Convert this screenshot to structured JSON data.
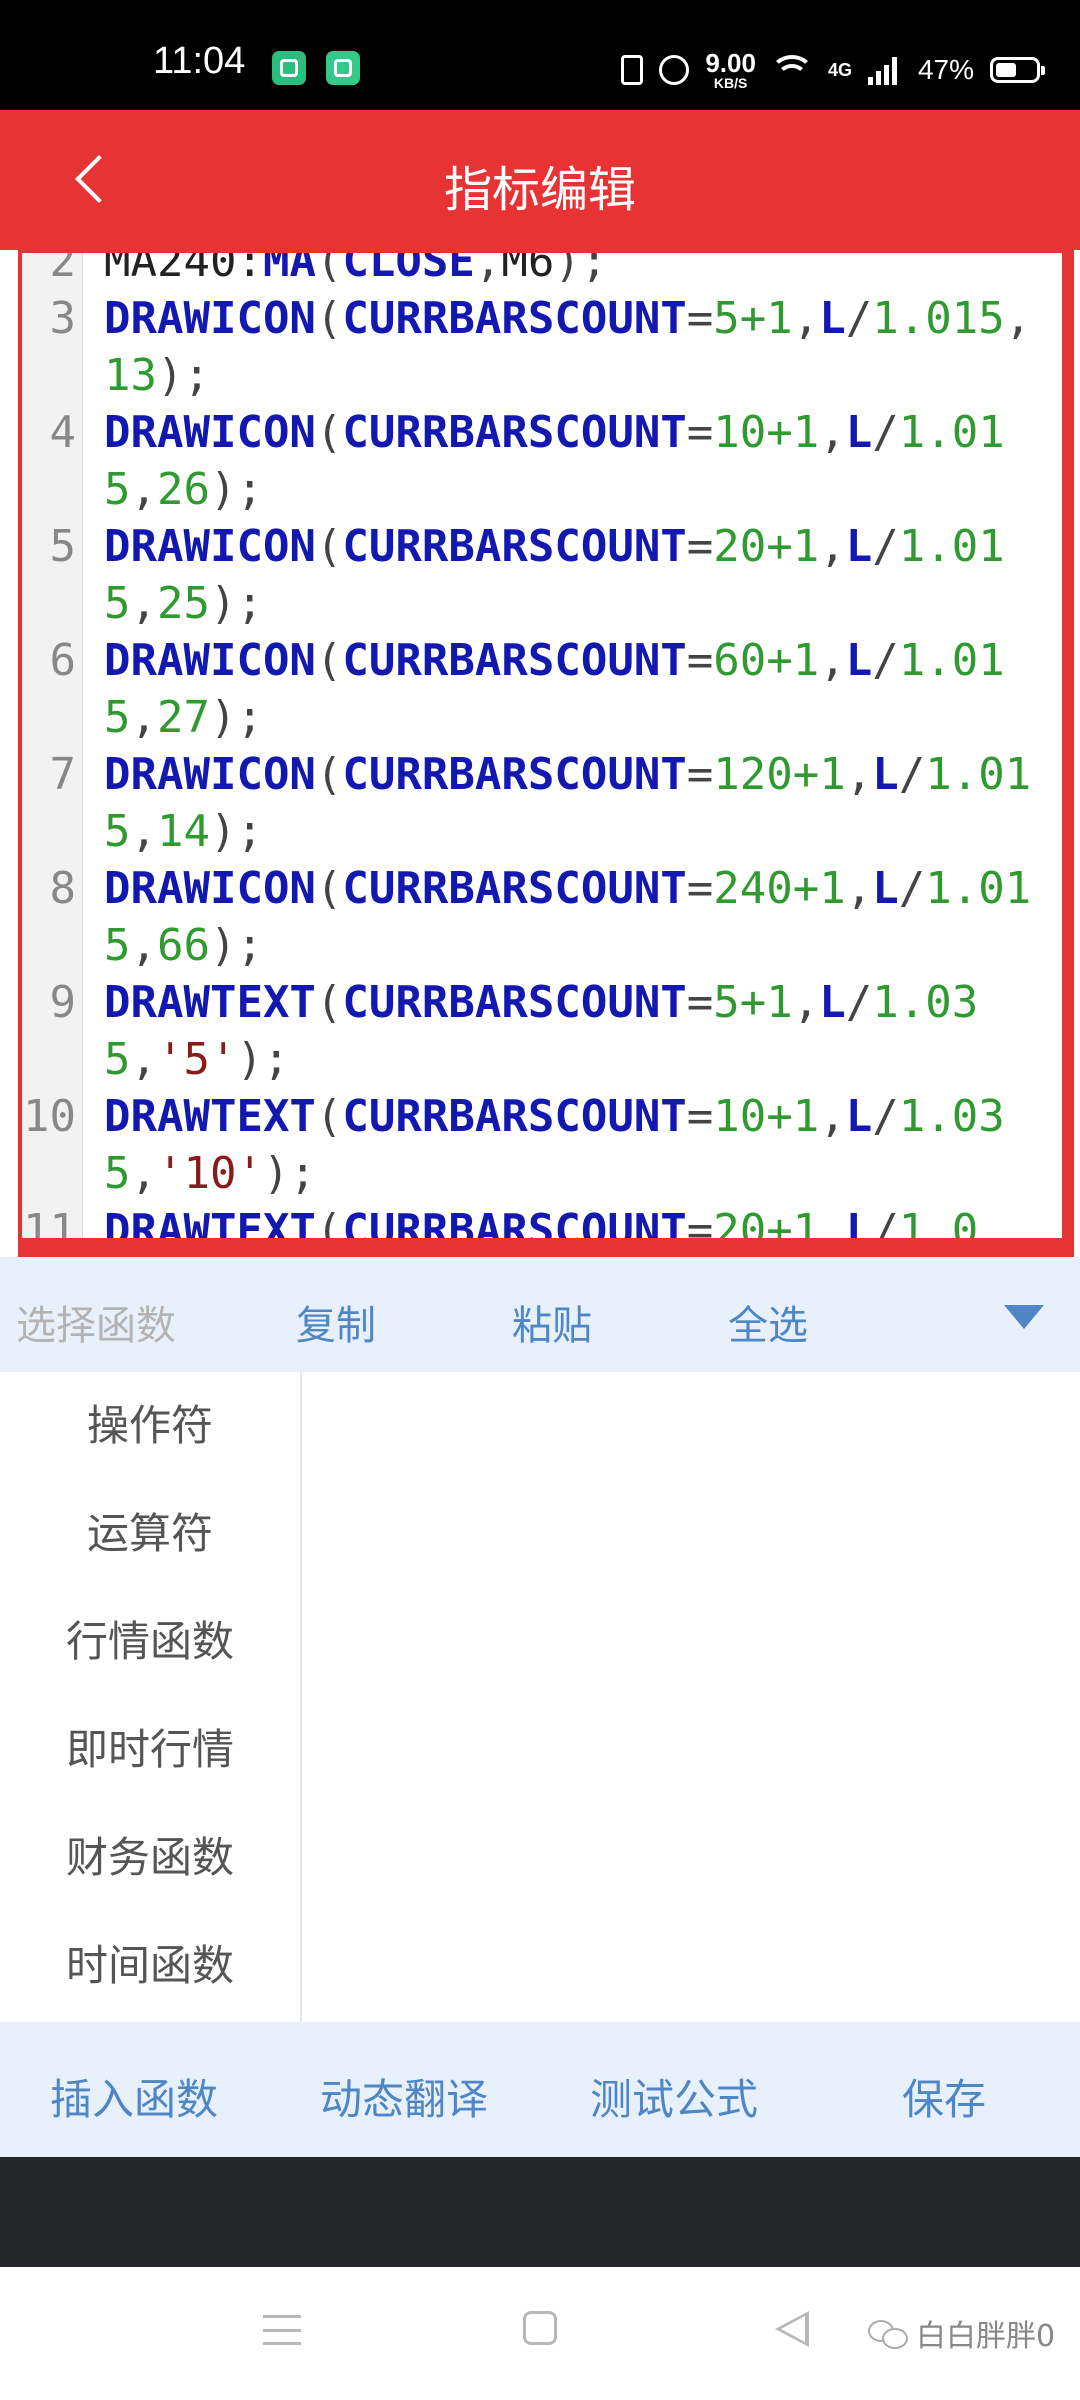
{
  "status_bar": {
    "time": "11:04",
    "net_speed_value": "9.00",
    "net_speed_unit": "KB/S",
    "network_type": "4G",
    "battery_percent": "47%"
  },
  "header": {
    "title": "指标编辑"
  },
  "editor": {
    "lines": [
      {
        "n": "2",
        "tokens": [
          {
            "c": "plain",
            "t": "MA240:"
          },
          {
            "c": "kw",
            "t": "MA"
          },
          {
            "c": "pn",
            "t": "("
          },
          {
            "c": "kw",
            "t": "CLOSE"
          },
          {
            "c": "pn",
            "t": ","
          },
          {
            "c": "plain",
            "t": "M6"
          },
          {
            "c": "pn",
            "t": ");"
          }
        ]
      },
      {
        "n": "3",
        "tokens": [
          {
            "c": "kw",
            "t": "DRAWICON"
          },
          {
            "c": "pn",
            "t": "("
          },
          {
            "c": "kw",
            "t": "CURRBARSCOUNT"
          },
          {
            "c": "pn",
            "t": "="
          },
          {
            "c": "num",
            "t": "5+1"
          },
          {
            "c": "pn",
            "t": ","
          },
          {
            "c": "kw",
            "t": "L"
          },
          {
            "c": "pn",
            "t": "/"
          },
          {
            "c": "num",
            "t": "1.015"
          },
          {
            "c": "pn",
            "t": ","
          },
          {
            "c": "num",
            "t": "13"
          },
          {
            "c": "pn",
            "t": ");"
          }
        ]
      },
      {
        "n": "4",
        "tokens": [
          {
            "c": "kw",
            "t": "DRAWICON"
          },
          {
            "c": "pn",
            "t": "("
          },
          {
            "c": "kw",
            "t": "CURRBARSCOUNT"
          },
          {
            "c": "pn",
            "t": "="
          },
          {
            "c": "num",
            "t": "10+1"
          },
          {
            "c": "pn",
            "t": ","
          },
          {
            "c": "kw",
            "t": "L"
          },
          {
            "c": "pn",
            "t": "/"
          },
          {
            "c": "num",
            "t": "1.015"
          },
          {
            "c": "pn",
            "t": ","
          },
          {
            "c": "num",
            "t": "26"
          },
          {
            "c": "pn",
            "t": ");"
          }
        ]
      },
      {
        "n": "5",
        "tokens": [
          {
            "c": "kw",
            "t": "DRAWICON"
          },
          {
            "c": "pn",
            "t": "("
          },
          {
            "c": "kw",
            "t": "CURRBARSCOUNT"
          },
          {
            "c": "pn",
            "t": "="
          },
          {
            "c": "num",
            "t": "20+1"
          },
          {
            "c": "pn",
            "t": ","
          },
          {
            "c": "kw",
            "t": "L"
          },
          {
            "c": "pn",
            "t": "/"
          },
          {
            "c": "num",
            "t": "1.015"
          },
          {
            "c": "pn",
            "t": ","
          },
          {
            "c": "num",
            "t": "25"
          },
          {
            "c": "pn",
            "t": ");"
          }
        ]
      },
      {
        "n": "6",
        "tokens": [
          {
            "c": "kw",
            "t": "DRAWICON"
          },
          {
            "c": "pn",
            "t": "("
          },
          {
            "c": "kw",
            "t": "CURRBARSCOUNT"
          },
          {
            "c": "pn",
            "t": "="
          },
          {
            "c": "num",
            "t": "60+1"
          },
          {
            "c": "pn",
            "t": ","
          },
          {
            "c": "kw",
            "t": "L"
          },
          {
            "c": "pn",
            "t": "/"
          },
          {
            "c": "num",
            "t": "1.015"
          },
          {
            "c": "pn",
            "t": ","
          },
          {
            "c": "num",
            "t": "27"
          },
          {
            "c": "pn",
            "t": ");"
          }
        ]
      },
      {
        "n": "7",
        "tokens": [
          {
            "c": "kw",
            "t": "DRAWICON"
          },
          {
            "c": "pn",
            "t": "("
          },
          {
            "c": "kw",
            "t": "CURRBARSCOUNT"
          },
          {
            "c": "pn",
            "t": "="
          },
          {
            "c": "num",
            "t": "120+1"
          },
          {
            "c": "pn",
            "t": ","
          },
          {
            "c": "kw",
            "t": "L"
          },
          {
            "c": "pn",
            "t": "/"
          },
          {
            "c": "num",
            "t": "1.015"
          },
          {
            "c": "pn",
            "t": ","
          },
          {
            "c": "num",
            "t": "14"
          },
          {
            "c": "pn",
            "t": ");"
          }
        ]
      },
      {
        "n": "8",
        "tokens": [
          {
            "c": "kw",
            "t": "DRAWICON"
          },
          {
            "c": "pn",
            "t": "("
          },
          {
            "c": "kw",
            "t": "CURRBARSCOUNT"
          },
          {
            "c": "pn",
            "t": "="
          },
          {
            "c": "num",
            "t": "240+1"
          },
          {
            "c": "pn",
            "t": ","
          },
          {
            "c": "kw",
            "t": "L"
          },
          {
            "c": "pn",
            "t": "/"
          },
          {
            "c": "num",
            "t": "1.015"
          },
          {
            "c": "pn",
            "t": ","
          },
          {
            "c": "num",
            "t": "66"
          },
          {
            "c": "pn",
            "t": ");"
          }
        ]
      },
      {
        "n": "9",
        "tokens": [
          {
            "c": "kw",
            "t": "DRAWTEXT"
          },
          {
            "c": "pn",
            "t": "("
          },
          {
            "c": "kw",
            "t": "CURRBARSCOUNT"
          },
          {
            "c": "pn",
            "t": "="
          },
          {
            "c": "num",
            "t": "5+1"
          },
          {
            "c": "pn",
            "t": ","
          },
          {
            "c": "kw",
            "t": "L"
          },
          {
            "c": "pn",
            "t": "/"
          },
          {
            "c": "num",
            "t": "1.035"
          },
          {
            "c": "pn",
            "t": ","
          },
          {
            "c": "str",
            "t": "'5'"
          },
          {
            "c": "pn",
            "t": ");"
          }
        ]
      },
      {
        "n": "10",
        "tokens": [
          {
            "c": "kw",
            "t": "DRAWTEXT"
          },
          {
            "c": "pn",
            "t": "("
          },
          {
            "c": "kw",
            "t": "CURRBARSCOUNT"
          },
          {
            "c": "pn",
            "t": "="
          },
          {
            "c": "num",
            "t": "10+1"
          },
          {
            "c": "pn",
            "t": ","
          },
          {
            "c": "kw",
            "t": "L"
          },
          {
            "c": "pn",
            "t": "/"
          },
          {
            "c": "num",
            "t": "1.035"
          },
          {
            "c": "pn",
            "t": ","
          },
          {
            "c": "str",
            "t": "'10'"
          },
          {
            "c": "pn",
            "t": ");"
          }
        ]
      },
      {
        "n": "11",
        "tokens": [
          {
            "c": "kw",
            "t": "DRAWTEXT"
          },
          {
            "c": "pn",
            "t": "("
          },
          {
            "c": "kw",
            "t": "CURRBARSCOUNT"
          },
          {
            "c": "pn",
            "t": "="
          },
          {
            "c": "num",
            "t": "20+1"
          },
          {
            "c": "pn",
            "t": ","
          },
          {
            "c": "kw",
            "t": "L"
          },
          {
            "c": "pn",
            "t": "/"
          },
          {
            "c": "num",
            "t": "1.0"
          }
        ]
      }
    ]
  },
  "toolbar": {
    "select_function": "选择函数",
    "copy": "复制",
    "paste": "粘贴",
    "select_all": "全选"
  },
  "categories": [
    "操作符",
    "运算符",
    "行情函数",
    "即时行情",
    "财务函数",
    "时间函数"
  ],
  "actions": {
    "insert_function": "插入函数",
    "dynamic_translate": "动态翻译",
    "test_formula": "测试公式",
    "save": "保存"
  },
  "watermark": "白白胖胖0",
  "colors": {
    "header_red": "#e83334",
    "keyword_blue": "#1318b0",
    "number_green": "#2f9a2f",
    "string_red": "#8b1a1a",
    "action_blue": "#4f86c6"
  },
  "icons": [
    "back-arrow-icon",
    "dropdown-arrow-icon",
    "menu-icon",
    "home-icon",
    "back-triangle-icon",
    "wechat-icon"
  ]
}
